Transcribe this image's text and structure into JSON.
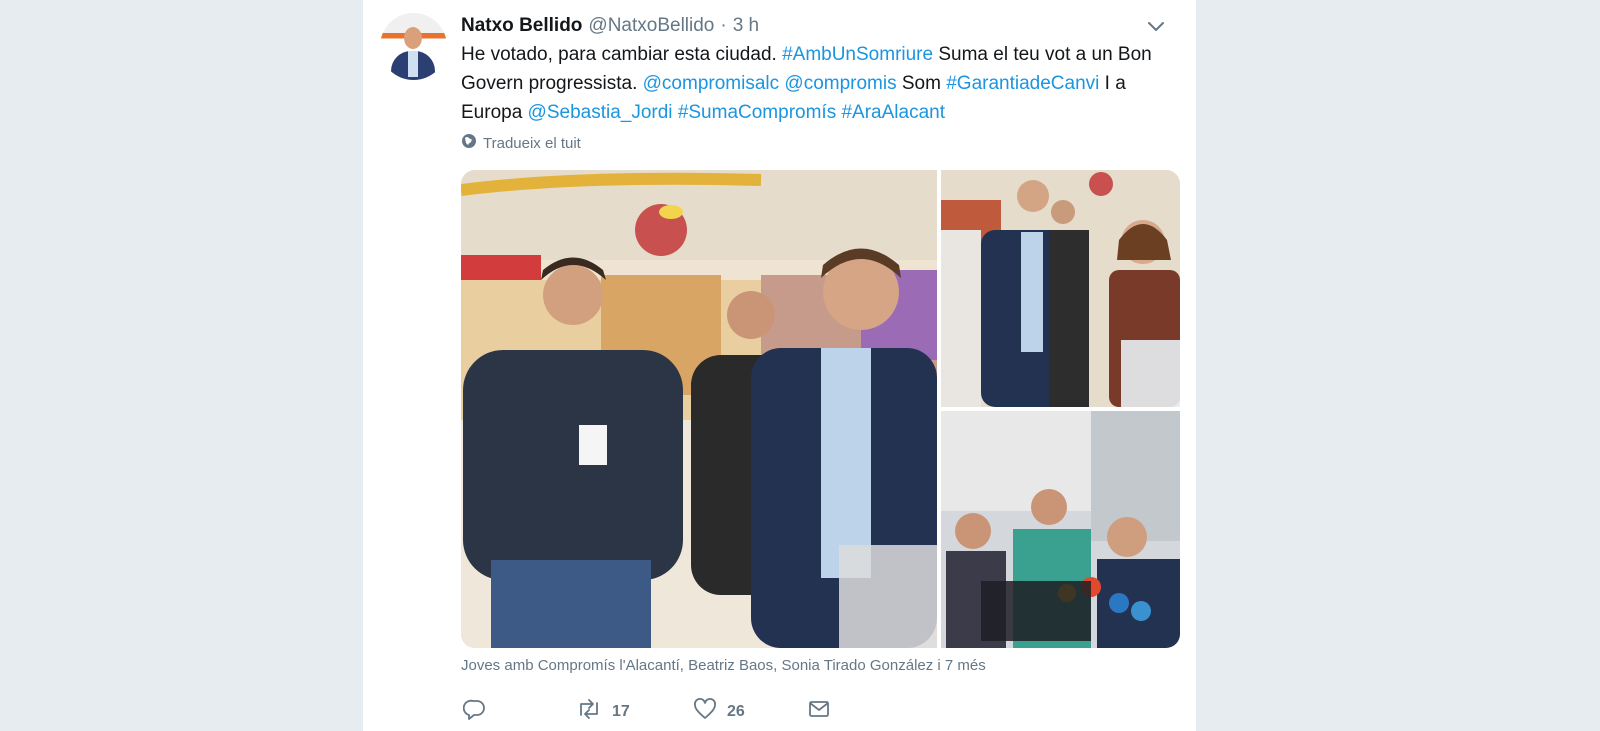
{
  "tweet": {
    "author_name": "Natxo Bellido",
    "author_handle": "@NatxoBellido",
    "separator": "·",
    "time": "3 h",
    "text_segments": [
      {
        "t": "He votado, para cambiar esta ciudad. ",
        "link": false
      },
      {
        "t": "#AmbUnSomriure",
        "link": true
      },
      {
        "t": " Suma el teu vot a un Bon Govern progressista. ",
        "link": false
      },
      {
        "t": "@compromisalc",
        "link": true
      },
      {
        "t": " ",
        "link": false
      },
      {
        "t": "@compromis",
        "link": true
      },
      {
        "t": " Som ",
        "link": false
      },
      {
        "t": "#GarantiadeCanvi",
        "link": true
      },
      {
        "t": " I a Europa ",
        "link": false
      },
      {
        "t": "@Sebastia_Jordi",
        "link": true
      },
      {
        "t": " ",
        "link": false
      },
      {
        "t": "#SumaCompromís",
        "link": true
      },
      {
        "t": " ",
        "link": false
      },
      {
        "t": "#AraAlacant",
        "link": true
      }
    ],
    "translate_label": "Tradueix el tuit",
    "tagged_caption": "Joves amb Compromís l'Alacantí, Beatriz Baos, Sonia Tirado González i 7 més",
    "retweets": "17",
    "likes": "26"
  },
  "icons": {
    "chevron": "chevron-down-icon",
    "globe": "globe-icon",
    "reply": "reply-icon",
    "retweet": "retweet-icon",
    "like": "heart-icon",
    "dm": "envelope-icon"
  },
  "colors": {
    "background": "#e6ecf0",
    "card": "#ffffff",
    "link": "#1b95e0",
    "secondary": "#657786",
    "primary": "#14171a"
  }
}
